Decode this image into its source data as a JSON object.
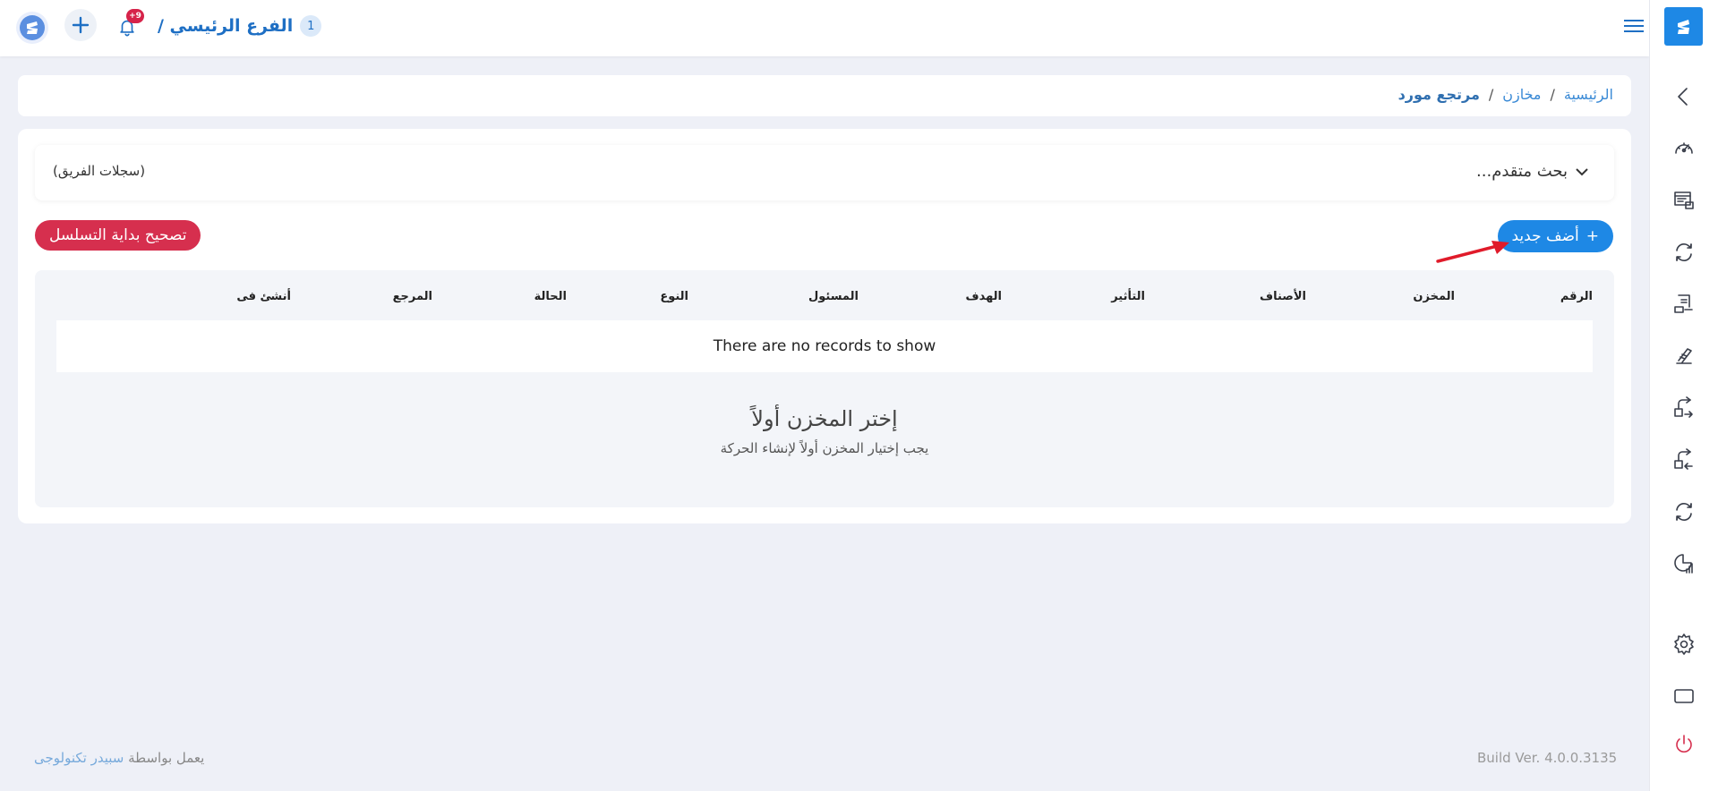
{
  "topbar": {
    "branch_number": "1",
    "branch_title": "الفرع الرئيسي /",
    "notification_badge": "+9",
    "icons": [
      "logo-icon",
      "plus-icon",
      "bell-icon",
      "menu-icon"
    ]
  },
  "sidebar": {
    "icons": [
      "collapse-chevron-icon",
      "dashboard-speedometer-icon",
      "warehouse-icon",
      "sync-icon",
      "invoice-icon",
      "tools-icon",
      "transfer-out-icon",
      "transfer-in-icon",
      "refresh-icon",
      "report-chart-icon",
      "settings-gear-icon",
      "screen-icon",
      "power-icon"
    ]
  },
  "breadcrumb": {
    "home": "الرئيسية",
    "sep1": "/",
    "stores": "مخازن",
    "sep2": "/",
    "current": "مرتجع مورد"
  },
  "search": {
    "advanced_label": "بحث متقدم...",
    "team_logs": "(سجلات الفريق)"
  },
  "actions": {
    "add_new": "أضف جديد",
    "add_icon": "+",
    "fix_sequence": "تصحيح بداية التسلسل"
  },
  "table": {
    "columns": [
      "الرقم",
      "المخزن",
      "الأصناف",
      "التأثير",
      "الهدف",
      "المسئول",
      "النوع",
      "الحالة",
      "المرجع",
      "أنشئ فى"
    ],
    "empty_message": "There are no records to show"
  },
  "empty_state": {
    "title": "إختر المخزن أولاً",
    "subtitle": "يجب إختيار المخزن أولاً لإنشاء الحركة"
  },
  "footer": {
    "powered_by": "يعمل بواسطة",
    "brand": "سبيدر تكنولوجى",
    "build": "Build Ver. 4.0.0.3135"
  },
  "colors": {
    "accent": "#1e88e5",
    "danger": "#d62f4e",
    "background": "#eef0f7",
    "link": "#3a8ad6"
  }
}
